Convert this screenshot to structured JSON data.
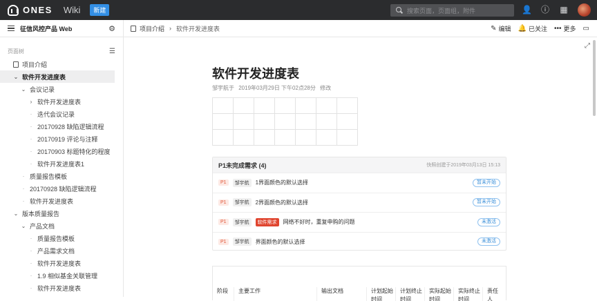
{
  "topbar": {
    "logo_text": "ONES",
    "wiki_label": "Wiki",
    "new_button": "新建",
    "search_placeholder": "搜索页面，页面组，附件"
  },
  "subbar": {
    "space_title": "征信风控产品 Web",
    "breadcrumb": [
      "项目介绍",
      "软件开发进度表"
    ],
    "actions": {
      "edit": "编辑",
      "follow": "已关注",
      "more": "更多"
    }
  },
  "sidebar": {
    "tree_label": "页面树",
    "items": [
      {
        "label": "项目介绍",
        "level": 0,
        "kind": "page"
      },
      {
        "label": "软件开发进度表",
        "level": 0,
        "kind": "expanded",
        "active": true
      },
      {
        "label": "会议记录",
        "level": 1,
        "kind": "expanded"
      },
      {
        "label": "软件开发进度表",
        "level": 2,
        "kind": "collapsed"
      },
      {
        "label": "迭代会议记录",
        "level": 2,
        "kind": "leaf"
      },
      {
        "label": "20170928 缺陷逻辑流程",
        "level": 2,
        "kind": "leaf"
      },
      {
        "label": "20170919 评论与注释",
        "level": 2,
        "kind": "leaf"
      },
      {
        "label": "20170903 标题特化的程度",
        "level": 2,
        "kind": "leaf"
      },
      {
        "label": "软件开发进度表1",
        "level": 2,
        "kind": "leaf"
      },
      {
        "label": "质量报告模板",
        "level": 1,
        "kind": "leaf"
      },
      {
        "label": "20170928 缺陷逻辑流程",
        "level": 1,
        "kind": "leaf"
      },
      {
        "label": "软件开发进度表",
        "level": 1,
        "kind": "leaf"
      },
      {
        "label": "版本质量报告",
        "level": 0,
        "kind": "expanded"
      },
      {
        "label": "产品文档",
        "level": 1,
        "kind": "expanded"
      },
      {
        "label": "质量报告模板",
        "level": 2,
        "kind": "leaf"
      },
      {
        "label": "产品需求文档",
        "level": 2,
        "kind": "leaf"
      },
      {
        "label": "软件开发进度表",
        "level": 2,
        "kind": "leaf"
      },
      {
        "label": "1.9 相似基金关联管理",
        "level": 2,
        "kind": "leaf"
      },
      {
        "label": "软件开发进度表",
        "level": 2,
        "kind": "leaf"
      }
    ]
  },
  "page": {
    "title": "软件开发进度表",
    "author": "邹宇航于",
    "date": "2019年03月29日 下午02点28分",
    "action": "修改"
  },
  "requirements": {
    "title": "P1未完成需求 (4)",
    "note": "快照创建于2019年03月13日 15:13",
    "rows": [
      {
        "priority": "P1",
        "owner": "邹宇航",
        "tag": "",
        "text": "1界面颜色的默认选择",
        "status": "暂未开始"
      },
      {
        "priority": "P1",
        "owner": "邹宇航",
        "tag": "",
        "text": "2界面颜色的默认选择",
        "status": "暂未开始"
      },
      {
        "priority": "P1",
        "owner": "邹宇航",
        "tag": "软件需求",
        "text": "网络不好时，重复申购的问题",
        "status": "未激活"
      },
      {
        "priority": "P1",
        "owner": "邹宇航",
        "tag": "",
        "text": "界面颜色的默认选择",
        "status": "未激活"
      }
    ]
  },
  "schedule_table": {
    "headers": [
      "阶段",
      "主要工作",
      "输出文档",
      "计划起始时间",
      "计划终止时间",
      "实际起始时间",
      "实际终止时间",
      "责任人"
    ]
  },
  "colors": {
    "accent": "#338fe5",
    "topbar": "#2b2c2e",
    "priority_red": "#e0583a",
    "status_blue": "#3a8fd9"
  }
}
